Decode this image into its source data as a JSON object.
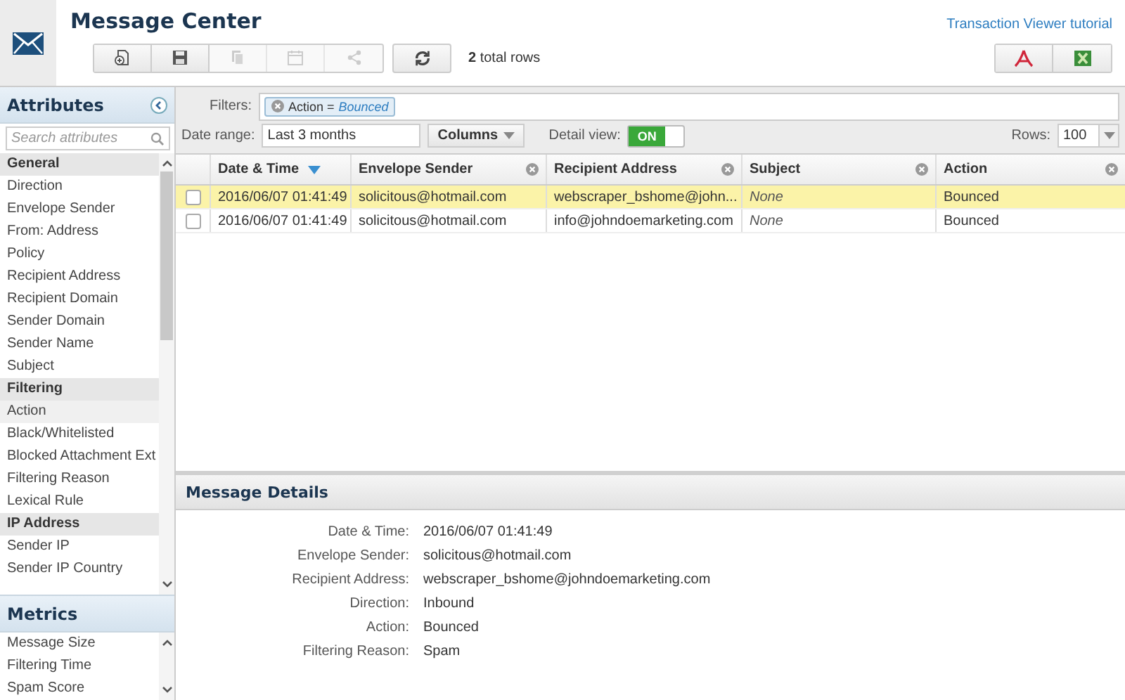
{
  "header": {
    "title": "Message Center",
    "tutorial_link": "Transaction Viewer tutorial",
    "total_rows": {
      "count": "2",
      "label": "total rows"
    },
    "toolbar": [
      {
        "kind": "new",
        "disabled": false
      },
      {
        "kind": "save",
        "disabled": false
      },
      {
        "kind": "copy",
        "disabled": true
      },
      {
        "kind": "calendar",
        "disabled": true
      },
      {
        "kind": "share",
        "disabled": true
      }
    ],
    "export": [
      {
        "kind": "pdf"
      },
      {
        "kind": "excel"
      }
    ]
  },
  "sidebar": {
    "title": "Attributes",
    "search": {
      "placeholder": "Search attributes"
    },
    "items": [
      {
        "kind": "group",
        "label": "General"
      },
      {
        "kind": "item",
        "label": "Direction",
        "selected": false
      },
      {
        "kind": "item",
        "label": "Envelope Sender",
        "selected": false
      },
      {
        "kind": "item",
        "label": "From: Address",
        "selected": false
      },
      {
        "kind": "item",
        "label": "Policy",
        "selected": false
      },
      {
        "kind": "item",
        "label": "Recipient Address",
        "selected": false
      },
      {
        "kind": "item",
        "label": "Recipient Domain",
        "selected": false
      },
      {
        "kind": "item",
        "label": "Sender Domain",
        "selected": false
      },
      {
        "kind": "item",
        "label": "Sender Name",
        "selected": false
      },
      {
        "kind": "item",
        "label": "Subject",
        "selected": false
      },
      {
        "kind": "group",
        "label": "Filtering"
      },
      {
        "kind": "item",
        "label": "Action",
        "selected": true
      },
      {
        "kind": "item",
        "label": "Black/Whitelisted",
        "selected": false
      },
      {
        "kind": "item",
        "label": "Blocked Attachment Ext",
        "selected": false
      },
      {
        "kind": "item",
        "label": "Filtering Reason",
        "selected": false
      },
      {
        "kind": "item",
        "label": "Lexical Rule",
        "selected": false
      },
      {
        "kind": "group",
        "label": "IP Address"
      },
      {
        "kind": "item",
        "label": "Sender IP",
        "selected": false
      },
      {
        "kind": "item",
        "label": "Sender IP Country",
        "selected": false
      }
    ],
    "metrics_title": "Metrics",
    "metrics": [
      "Message Size",
      "Filtering Time",
      "Spam Score"
    ]
  },
  "filters": {
    "label": "Filters:",
    "chips": [
      {
        "field": "Action =",
        "value": "Bounced"
      }
    ]
  },
  "controls": {
    "date_range_label": "Date range:",
    "date_range": "Last 3 months",
    "columns_button": "Columns",
    "detail_view_label": "Detail view:",
    "detail_view": {
      "on": true,
      "text": "ON"
    },
    "rows_label": "Rows:",
    "rows_value": "100"
  },
  "table": {
    "columns": [
      {
        "label": "Date & Time",
        "sorted": true,
        "removable": false
      },
      {
        "label": "Envelope Sender",
        "sorted": false,
        "removable": true
      },
      {
        "label": "Recipient Address",
        "sorted": false,
        "removable": true
      },
      {
        "label": "Subject",
        "sorted": false,
        "removable": true
      },
      {
        "label": "Action",
        "sorted": false,
        "removable": true
      }
    ],
    "rows": [
      {
        "selected": true,
        "checked": false,
        "cells": [
          "2016/06/07 01:41:49",
          "solicitous@hotmail.com",
          "webscraper_bshome@john...",
          "None",
          "Bounced"
        ]
      },
      {
        "selected": false,
        "checked": false,
        "cells": [
          "2016/06/07 01:41:49",
          "solicitous@hotmail.com",
          "info@johndoemarketing.com",
          "None",
          "Bounced"
        ]
      }
    ]
  },
  "details": {
    "title": "Message Details",
    "fields": [
      {
        "label": "Date & Time:",
        "value": "2016/06/07 01:41:49"
      },
      {
        "label": "Envelope Sender:",
        "value": "solicitous@hotmail.com"
      },
      {
        "label": "Recipient Address:",
        "value": "webscraper_bshome@johndoemarketing.com"
      },
      {
        "label": "Direction:",
        "value": "Inbound"
      },
      {
        "label": "Action:",
        "value": "Bounced"
      },
      {
        "label": "Filtering Reason:",
        "value": "Spam"
      }
    ]
  }
}
